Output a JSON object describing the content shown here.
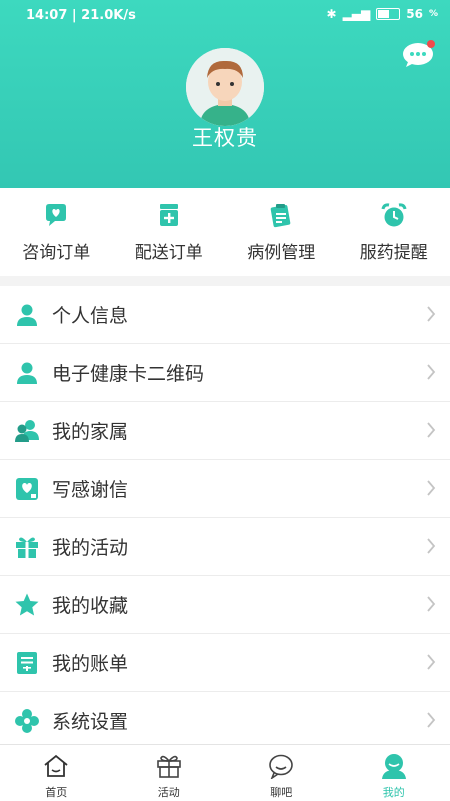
{
  "status": {
    "left": "14:07 | 21.0K/s",
    "battery": "56"
  },
  "profile": {
    "name": "王权贵"
  },
  "quick": [
    {
      "label": "咨询订单",
      "icon": "consult-icon"
    },
    {
      "label": "配送订单",
      "icon": "delivery-icon"
    },
    {
      "label": "病例管理",
      "icon": "case-icon"
    },
    {
      "label": "服药提醒",
      "icon": "alarm-icon"
    }
  ],
  "menu": [
    {
      "label": "个人信息",
      "icon": "person-icon"
    },
    {
      "label": "电子健康卡二维码",
      "icon": "person-icon"
    },
    {
      "label": "我的家属",
      "icon": "family-icon"
    },
    {
      "label": "写感谢信",
      "icon": "letter-icon"
    },
    {
      "label": "我的活动",
      "icon": "gift-icon"
    },
    {
      "label": "我的收藏",
      "icon": "star-icon"
    },
    {
      "label": "我的账单",
      "icon": "bill-icon"
    },
    {
      "label": "系统设置",
      "icon": "settings-icon"
    }
  ],
  "tabs": [
    {
      "label": "首页"
    },
    {
      "label": "活动"
    },
    {
      "label": "聊吧"
    },
    {
      "label": "我的"
    }
  ],
  "colors": {
    "accent": "#2fc4ac",
    "header": "#3dd9bf"
  }
}
